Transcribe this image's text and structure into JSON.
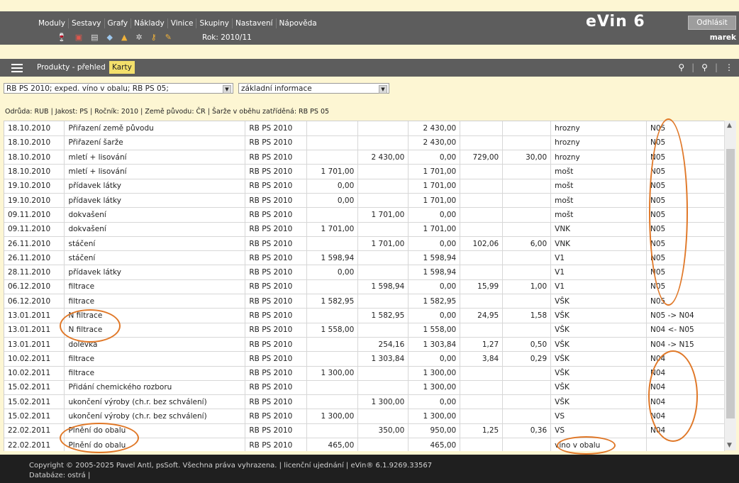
{
  "app": {
    "brand": "eVin 6",
    "logout_label": "Odhlásit",
    "user": "marek",
    "year_label": "Rok: 2010/11"
  },
  "menu": [
    "Moduly",
    "Sestavy",
    "Grafy",
    "Náklady",
    "Vinice",
    "Skupiny",
    "Nastavení",
    "Nápověda"
  ],
  "icons": [
    "wine-glasses-icon",
    "barrel-icon",
    "document-icon",
    "tag-icon",
    "bottle-icon",
    "gear-icon",
    "key-icon",
    "wand-icon"
  ],
  "toolbar": {
    "tab_overview": "Produkty - přehled",
    "tab_cards": "Karty"
  },
  "filters": {
    "product_select": "RB PS 2010; exped. víno v obalu; RB PS 05;",
    "view_select": "základní informace"
  },
  "info_line": "Odrůda: RUB | Jakost: PS | Ročník: 2010 | Země původu: ČR | Šarže v oběhu zatříděná: RB PS 05",
  "rows": [
    [
      "18.10.2010",
      "Přiřazení země původu",
      "RB PS 2010",
      "",
      "",
      "2 430,00",
      "",
      "",
      "hrozny",
      "N05"
    ],
    [
      "18.10.2010",
      "Přiřazení šarže",
      "RB PS 2010",
      "",
      "",
      "2 430,00",
      "",
      "",
      "hrozny",
      "N05"
    ],
    [
      "18.10.2010",
      "mletí + lisování",
      "RB PS 2010",
      "",
      "2 430,00",
      "0,00",
      "729,00",
      "30,00",
      "hrozny",
      "N05"
    ],
    [
      "18.10.2010",
      "mletí + lisování",
      "RB PS 2010",
      "1 701,00",
      "",
      "1 701,00",
      "",
      "",
      "mošt",
      "N05"
    ],
    [
      "19.10.2010",
      "přídavek látky",
      "RB PS 2010",
      "0,00",
      "",
      "1 701,00",
      "",
      "",
      "mošt",
      "N05"
    ],
    [
      "19.10.2010",
      "přídavek látky",
      "RB PS 2010",
      "0,00",
      "",
      "1 701,00",
      "",
      "",
      "mošt",
      "N05"
    ],
    [
      "09.11.2010",
      "dokvašení",
      "RB PS 2010",
      "",
      "1 701,00",
      "0,00",
      "",
      "",
      "mošt",
      "N05"
    ],
    [
      "09.11.2010",
      "dokvašení",
      "RB PS 2010",
      "1 701,00",
      "",
      "1 701,00",
      "",
      "",
      "VNK",
      "N05"
    ],
    [
      "26.11.2010",
      "stáčení",
      "RB PS 2010",
      "",
      "1 701,00",
      "0,00",
      "102,06",
      "6,00",
      "VNK",
      "N05"
    ],
    [
      "26.11.2010",
      "stáčení",
      "RB PS 2010",
      "1 598,94",
      "",
      "1 598,94",
      "",
      "",
      "V1",
      "N05"
    ],
    [
      "28.11.2010",
      "přídavek látky",
      "RB PS 2010",
      "0,00",
      "",
      "1 598,94",
      "",
      "",
      "V1",
      "N05"
    ],
    [
      "06.12.2010",
      "filtrace",
      "RB PS 2010",
      "",
      "1 598,94",
      "0,00",
      "15,99",
      "1,00",
      "V1",
      "N05"
    ],
    [
      "06.12.2010",
      "filtrace",
      "RB PS 2010",
      "1 582,95",
      "",
      "1 582,95",
      "",
      "",
      "VŠK",
      "N05"
    ],
    [
      "13.01.2011",
      "N filtrace",
      "RB PS 2010",
      "",
      "1 582,95",
      "0,00",
      "24,95",
      "1,58",
      "VŠK",
      "N05 -> N04"
    ],
    [
      "13.01.2011",
      "N filtrace",
      "RB PS 2010",
      "1 558,00",
      "",
      "1 558,00",
      "",
      "",
      "VŠK",
      "N04 <- N05"
    ],
    [
      "13.01.2011",
      "dolévka",
      "RB PS 2010",
      "",
      "254,16",
      "1 303,84",
      "1,27",
      "0,50",
      "VŠK",
      "N04 -> N15"
    ],
    [
      "10.02.2011",
      "filtrace",
      "RB PS 2010",
      "",
      "1 303,84",
      "0,00",
      "3,84",
      "0,29",
      "VŠK",
      "N04"
    ],
    [
      "10.02.2011",
      "filtrace",
      "RB PS 2010",
      "1 300,00",
      "",
      "1 300,00",
      "",
      "",
      "VŠK",
      "N04"
    ],
    [
      "15.02.2011",
      "Přidání chemického rozboru",
      "RB PS 2010",
      "",
      "",
      "1 300,00",
      "",
      "",
      "VŠK",
      "N04"
    ],
    [
      "15.02.2011",
      "ukončení výroby (ch.r. bez schválení)",
      "RB PS 2010",
      "",
      "1 300,00",
      "0,00",
      "",
      "",
      "VŠK",
      "N04"
    ],
    [
      "15.02.2011",
      "ukončení výroby (ch.r. bez schválení)",
      "RB PS 2010",
      "1 300,00",
      "",
      "1 300,00",
      "",
      "",
      "VS",
      "N04"
    ],
    [
      "22.02.2011",
      "Plnění do obalu",
      "RB PS 2010",
      "",
      "350,00",
      "950,00",
      "1,25",
      "0,36",
      "VS",
      "N04"
    ],
    [
      "22.02.2011",
      "Plnění do obalu",
      "RB PS 2010",
      "465,00",
      "",
      "465,00",
      "",
      "",
      "víno v obalu",
      ""
    ]
  ],
  "footer": {
    "copyright": "Copyright © 2005-2025 Pavel Antl, psSoft. Všechna práva vyhrazena.  |  licenční ujednání  | eVin® 6.1.9269.33567",
    "database": "Databáze: ostrá  |"
  },
  "colors": {
    "bar": "#5d5d5d",
    "background": "#fdf6d3",
    "tab_active": "#f3e06b",
    "annotation": "#e07828"
  }
}
